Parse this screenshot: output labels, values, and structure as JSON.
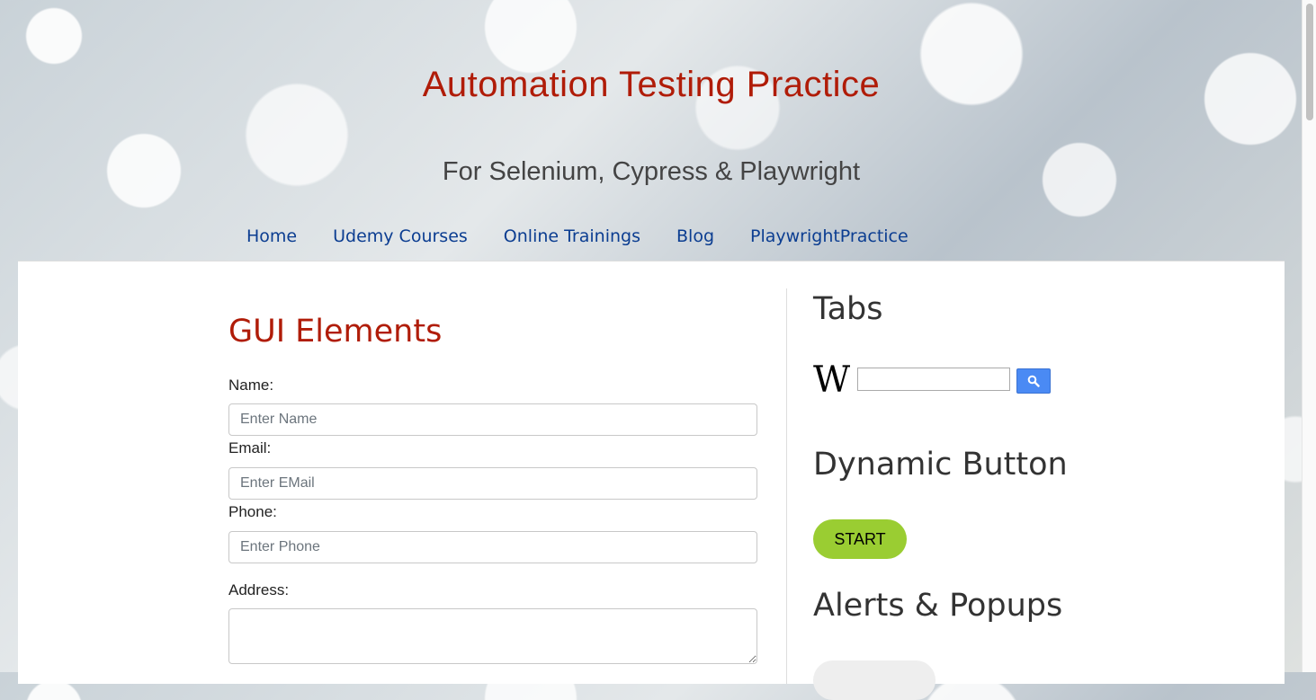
{
  "header": {
    "title": "Automation Testing Practice",
    "subtitle": "For Selenium, Cypress & Playwright"
  },
  "nav": {
    "items": [
      "Home",
      "Udemy Courses",
      "Online Trainings",
      "Blog",
      "PlaywrightPractice"
    ]
  },
  "gui": {
    "title": "GUI Elements",
    "name_label": "Name:",
    "name_placeholder": "Enter Name",
    "email_label": "Email:",
    "email_placeholder": "Enter EMail",
    "phone_label": "Phone:",
    "phone_placeholder": "Enter Phone",
    "address_label": "Address:"
  },
  "sidebar": {
    "tabs_heading": "Tabs",
    "wiki_logo": "W",
    "wiki_search_icon": "search-icon",
    "dynamic_heading": "Dynamic Button",
    "start_label": "START",
    "alerts_heading": "Alerts & Popups"
  },
  "colors": {
    "title_red": "#b01c08",
    "nav_blue": "#0b3d91",
    "start_green": "#9acd32",
    "wiki_button_blue": "#4a8af4"
  }
}
